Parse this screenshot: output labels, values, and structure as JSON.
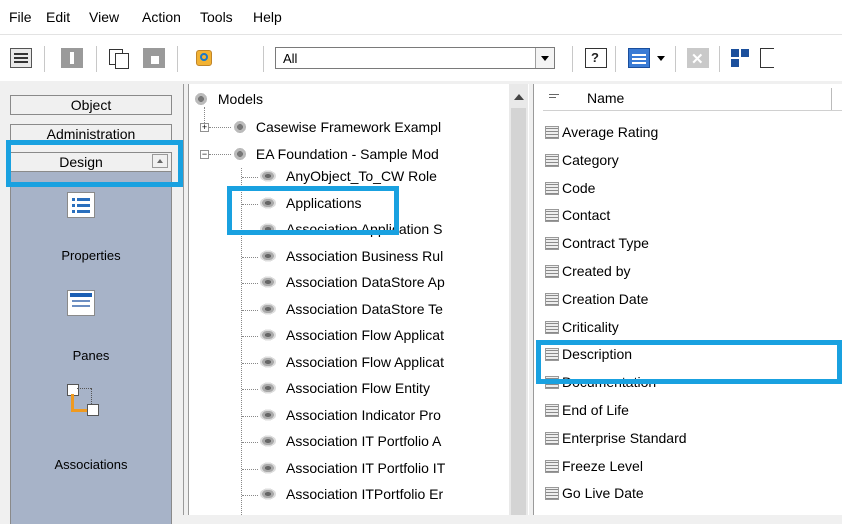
{
  "menu": [
    "File",
    "Edit",
    "View",
    "Action",
    "Tools",
    "Help"
  ],
  "toolbar": {
    "filter_value": "All"
  },
  "outlook": {
    "bars": [
      "Object",
      "Administration",
      "Design"
    ],
    "items": [
      "Properties",
      "Panes",
      "Associations"
    ]
  },
  "tree": {
    "root": "Models",
    "nodes": [
      "Casewise Framework Exampl",
      "EA Foundation - Sample Mod",
      "AnyObject_To_CW Role",
      "Applications",
      "Association Application S",
      "Association Business Rul",
      "Association DataStore Ap",
      "Association DataStore Te",
      "Association Flow Applicat",
      "Association Flow Applicat",
      "Association Flow Entity",
      "Association Indicator Pro",
      "Association IT Portfolio A",
      "Association IT Portfolio IT",
      "Association ITPortfolio Er"
    ]
  },
  "list": {
    "header": "Name",
    "items": [
      "Average Rating",
      "Category",
      "Code",
      "Contact",
      "Contract Type",
      "Created by",
      "Creation Date",
      "Criticality",
      "Description",
      "Documentation",
      "End of Life",
      "Enterprise Standard",
      "Freeze Level",
      "Go Live Date"
    ]
  },
  "colors": {
    "highlight": "#19a1e0",
    "pane_bg": "#a7b3c8"
  }
}
